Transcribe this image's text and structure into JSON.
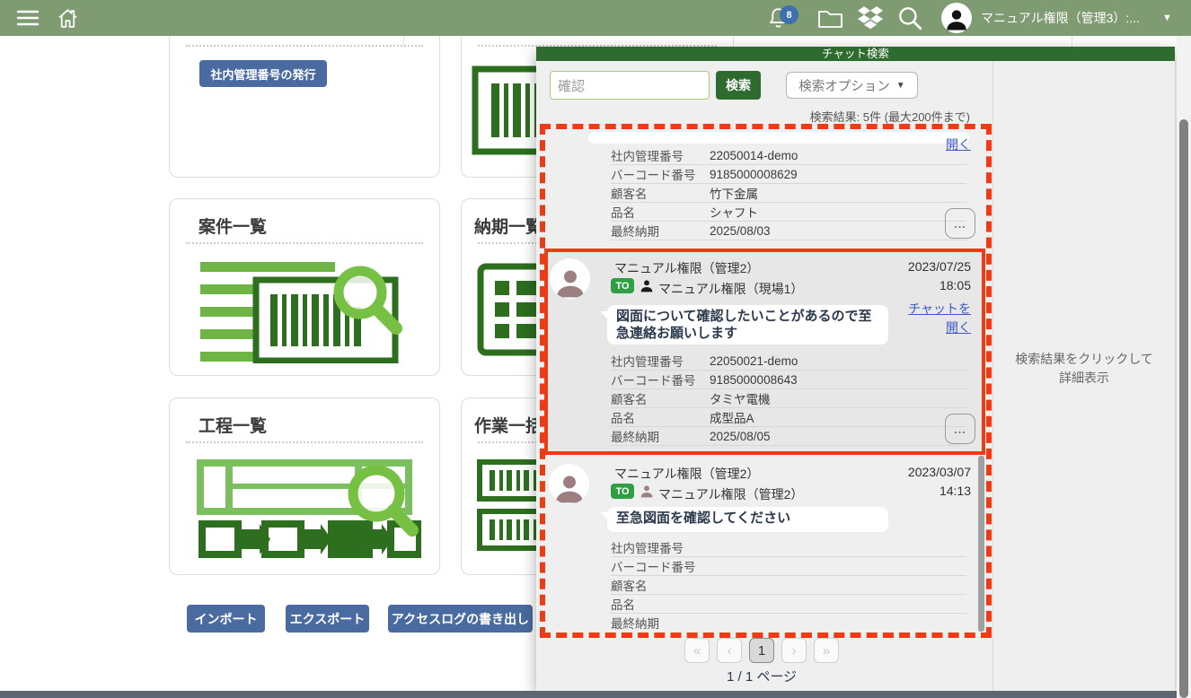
{
  "header": {
    "user_label": "マニュアル権限（管理3）:...",
    "notification_count": "8",
    "caret": "▼"
  },
  "background": {
    "issue_button": "社内管理番号の発行",
    "cards": [
      {
        "title": "案件一覧"
      },
      {
        "title": "納期一覧"
      },
      {
        "title": "工程一覧"
      },
      {
        "title": "作業一括"
      }
    ],
    "footer_buttons": {
      "import": "インポート",
      "export": "エクスポート",
      "access_log": "アクセスログの書き出し"
    }
  },
  "panel": {
    "title": "チャット検索",
    "search": {
      "value": "確認",
      "search_button": "検索",
      "options_button": "検索オプション",
      "options_caret": "▼"
    },
    "summary": "検索結果: 5件 (最大200件まで)",
    "dots_label": "...",
    "results": [
      {
        "open_link": "開く",
        "fields": [
          {
            "label": "社内管理番号",
            "value": "22050014-demo"
          },
          {
            "label": "バーコード番号",
            "value": "9185000008629"
          },
          {
            "label": "顧客名",
            "value": "竹下金属"
          },
          {
            "label": "品名",
            "value": "シャフト"
          },
          {
            "label": "最終納期",
            "value": "2025/08/03"
          }
        ]
      },
      {
        "sender": "マニュアル権限（管理2）",
        "to_badge": "TO",
        "to_name": "マニュアル権限（現場1）",
        "date": "2023/07/25",
        "time": "18:05",
        "link_line1": "チャットを",
        "link_line2": "開く",
        "message": "図面について確認したいことがあるので至急連絡お願いします",
        "fields": [
          {
            "label": "社内管理番号",
            "value": "22050021-demo"
          },
          {
            "label": "バーコード番号",
            "value": "9185000008643"
          },
          {
            "label": "顧客名",
            "value": "タミヤ電機"
          },
          {
            "label": "品名",
            "value": "成型品A"
          },
          {
            "label": "最終納期",
            "value": "2025/08/05"
          }
        ]
      },
      {
        "sender": "マニュアル権限（管理2）",
        "to_badge": "TO",
        "to_name": "マニュアル権限（管理2）",
        "date": "2023/03/07",
        "time": "14:13",
        "message": "至急図面を確認してください",
        "fields": [
          {
            "label": "社内管理番号",
            "value": ""
          },
          {
            "label": "バーコード番号",
            "value": ""
          },
          {
            "label": "顧客名",
            "value": ""
          },
          {
            "label": "品名",
            "value": ""
          },
          {
            "label": "最終納期",
            "value": ""
          }
        ]
      }
    ],
    "pagination": {
      "first": "«",
      "prev": "‹",
      "page": "1",
      "next": "›",
      "last": "»",
      "label": "1 / 1 ページ"
    },
    "hint_line1": "検索結果をクリックして",
    "hint_line2": "詳細表示"
  }
}
